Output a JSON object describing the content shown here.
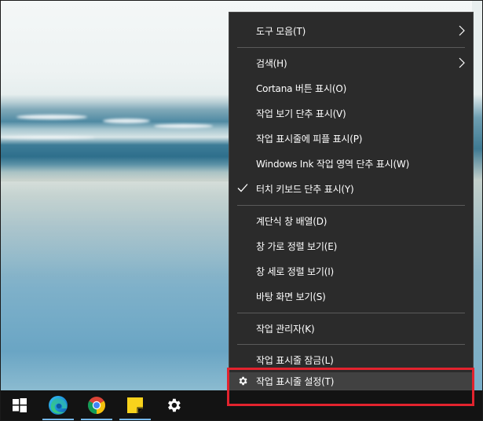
{
  "context_menu": {
    "items": [
      {
        "label": "도구 모음(T)",
        "submenu": true
      },
      {
        "label": "검색(H)",
        "submenu": true
      },
      {
        "label": "Cortana 버튼 표시(O)"
      },
      {
        "label": "작업 보기 단추 표시(V)"
      },
      {
        "label": "작업 표시줄에 피플 표시(P)"
      },
      {
        "label": "Windows Ink 작업 영역 단추 표시(W)"
      },
      {
        "label": "터치 키보드 단추 표시(Y)",
        "checked": true
      },
      {
        "label": "계단식 창 배열(D)"
      },
      {
        "label": "창 가로 정렬 보기(E)"
      },
      {
        "label": "창 세로 정렬 보기(I)"
      },
      {
        "label": "바탕 화면 보기(S)"
      },
      {
        "label": "작업 관리자(K)"
      },
      {
        "label": "작업 표시줄 잠금(L)"
      },
      {
        "label": "작업 표시줄 설정(T)",
        "icon": "gear-icon",
        "hovered": true
      }
    ]
  },
  "taskbar": {
    "apps": [
      {
        "name": "start",
        "icon": "windows-logo-icon"
      },
      {
        "name": "edge",
        "icon": "edge-icon",
        "active": true
      },
      {
        "name": "chrome",
        "icon": "chrome-icon",
        "active": true
      },
      {
        "name": "sticky-notes",
        "icon": "sticky-notes-icon",
        "active": true
      },
      {
        "name": "settings",
        "icon": "gear-icon"
      }
    ]
  },
  "colors": {
    "menu_bg": "#2b2b2b",
    "menu_hover": "#414141",
    "highlight_border": "#e2232e",
    "taskbar_bg": "#131313",
    "active_indicator": "#76b9ed"
  }
}
